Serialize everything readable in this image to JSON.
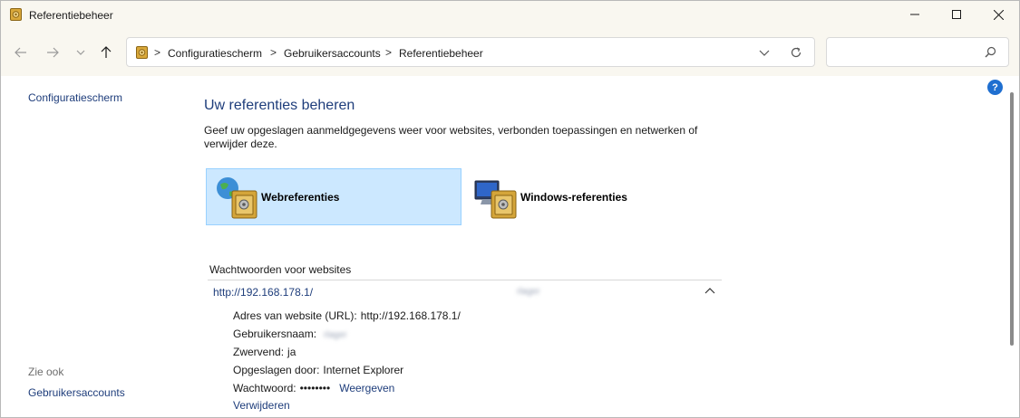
{
  "window": {
    "title": "Referentiebeheer"
  },
  "breadcrumb": {
    "items": [
      "Configuratiescherm",
      "Gebruikersaccounts",
      "Referentiebeheer"
    ],
    "separator": ">"
  },
  "search": {
    "placeholder": ""
  },
  "sidebar": {
    "home_link": "Configuratiescherm",
    "see_also_heading": "Zie ook",
    "see_also_link": "Gebruikersaccounts"
  },
  "main": {
    "title": "Uw referenties beheren",
    "description": "Geef uw opgeslagen aanmeldgegevens weer voor websites, verbonden toepassingen en netwerken of verwijder deze.",
    "tiles": [
      {
        "label": "Webreferenties",
        "selected": true,
        "icon": "globe-vault-icon"
      },
      {
        "label": "Windows-referenties",
        "selected": false,
        "icon": "monitor-vault-icon"
      }
    ],
    "section_heading": "Wachtwoorden voor websites",
    "credential": {
      "url": "http://192.168.178.1/",
      "user_blurred": "rlager",
      "details": {
        "address_label": "Adres van website (URL):",
        "address_value": "http://192.168.178.1/",
        "username_label": "Gebruikersnaam:",
        "username_value": "rlager",
        "roaming_label": "Zwervend:",
        "roaming_value": "ja",
        "saved_by_label": "Opgeslagen door:",
        "saved_by_value": "Internet Explorer",
        "password_label": "Wachtwoord:",
        "password_value": "••••••••",
        "show_link": "Weergeven",
        "remove_link": "Verwijderen"
      }
    }
  },
  "colors": {
    "link": "#1e3d7b",
    "tile_selected_bg": "#cce8ff",
    "chrome_bg": "#f9f7f0"
  }
}
